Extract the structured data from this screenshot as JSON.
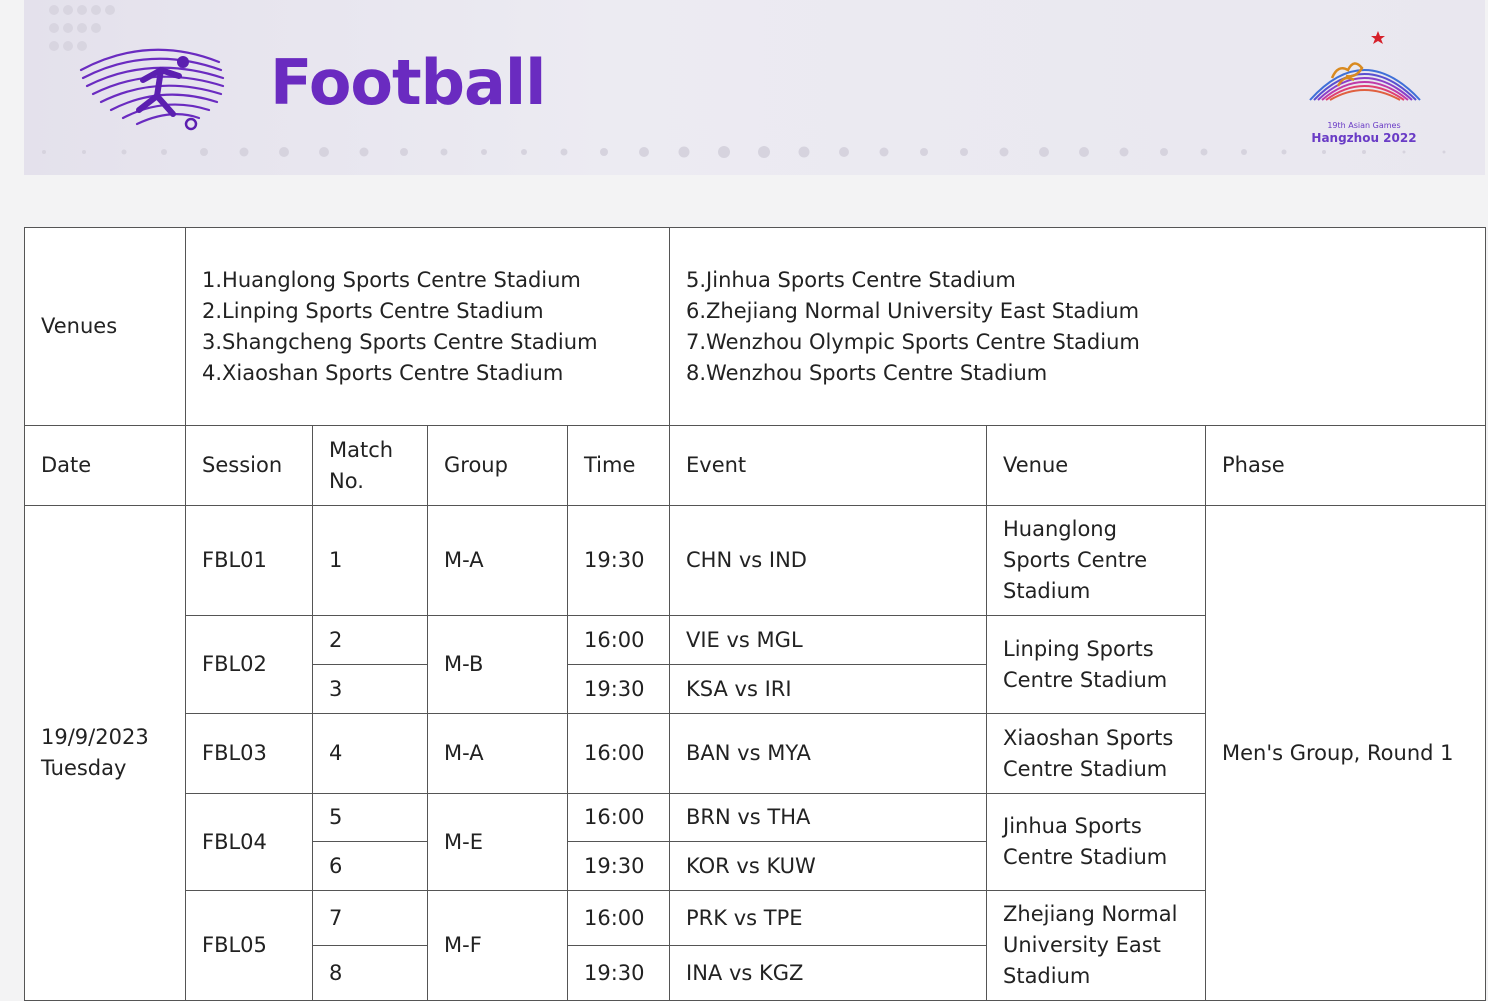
{
  "header": {
    "title": "Football",
    "logo_caption_line1": "19th Asian Games",
    "logo_caption_line2": "Hangzhou 2022"
  },
  "venues_row": {
    "label": "Venues",
    "list_left": [
      "1.Huanglong Sports Centre Stadium",
      "2.Linping Sports Centre Stadium",
      "3.Shangcheng Sports Centre Stadium",
      "4.Xiaoshan Sports Centre Stadium"
    ],
    "list_right": [
      "5.Jinhua Sports Centre Stadium",
      "6.Zhejiang Normal University East Stadium",
      "7.Wenzhou Olympic Sports Centre Stadium",
      "8.Wenzhou Sports Centre Stadium"
    ]
  },
  "columns": {
    "date": "Date",
    "session": "Session",
    "match_no_line1": "Match",
    "match_no_line2": "No.",
    "group": "Group",
    "time": "Time",
    "event": "Event",
    "venue": "Venue",
    "phase": "Phase"
  },
  "schedule": {
    "date_line1": "19/9/2023",
    "date_line2": "Tuesday",
    "phase": "Men's Group, Round 1",
    "sessions": [
      {
        "session": "FBL01",
        "group": "M-A",
        "venue": "Huanglong Sports Centre Stadium",
        "matches": [
          {
            "no": "1",
            "time": "19:30",
            "event": "CHN vs IND"
          }
        ]
      },
      {
        "session": "FBL02",
        "group": "M-B",
        "venue": "Linping Sports Centre Stadium",
        "matches": [
          {
            "no": "2",
            "time": "16:00",
            "event": "VIE vs MGL"
          },
          {
            "no": "3",
            "time": "19:30",
            "event": "KSA vs IRI"
          }
        ]
      },
      {
        "session": "FBL03",
        "group": "M-A",
        "venue": "Xiaoshan Sports Centre Stadium",
        "matches": [
          {
            "no": "4",
            "time": "16:00",
            "event": "BAN vs MYA"
          }
        ]
      },
      {
        "session": "FBL04",
        "group": "M-E",
        "venue": "Jinhua Sports Centre Stadium",
        "matches": [
          {
            "no": "5",
            "time": "16:00",
            "event": "BRN vs THA"
          },
          {
            "no": "6",
            "time": "19:30",
            "event": "KOR vs KUW"
          }
        ]
      },
      {
        "session": "FBL05",
        "group": "M-F",
        "venue": "Zhejiang Normal University East Stadium",
        "matches": [
          {
            "no": "7",
            "time": "16:00",
            "event": "PRK vs TPE"
          },
          {
            "no": "8",
            "time": "19:30",
            "event": "INA vs KGZ"
          }
        ]
      }
    ]
  },
  "colors": {
    "title_purple": "#6a2bc0",
    "logo_red": "#d6202a",
    "border": "#555555"
  }
}
